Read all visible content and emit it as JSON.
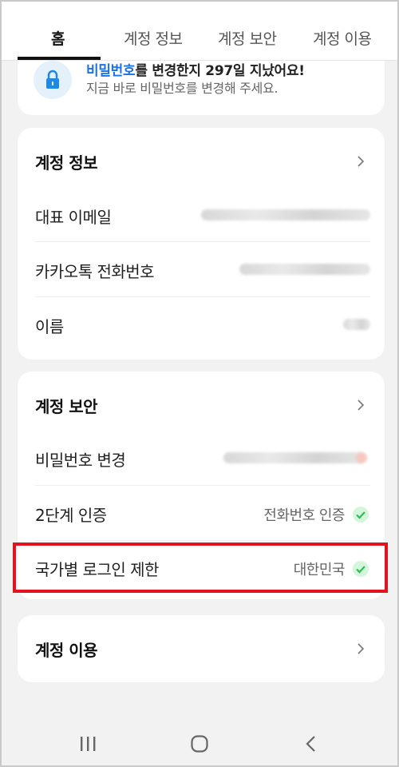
{
  "tabs": [
    {
      "label": "홈",
      "active": true
    },
    {
      "label": "계정 정보",
      "active": false
    },
    {
      "label": "계정 보안",
      "active": false
    },
    {
      "label": "계정 이용",
      "active": false
    }
  ],
  "notice": {
    "title_highlight": "비밀번호",
    "title_rest": "를 변경한지 297일 지났어요!",
    "subtitle": "지금 바로 비밀번호를 변경해 주세요.",
    "icon": "lock-icon"
  },
  "account_info": {
    "title": "계정 정보",
    "rows": [
      {
        "label": "대표 이메일"
      },
      {
        "label": "카카오톡 전화번호"
      },
      {
        "label": "이름"
      }
    ]
  },
  "account_security": {
    "title": "계정 보안",
    "rows": [
      {
        "label": "비밀번호 변경"
      },
      {
        "label": "2단계 인증",
        "value": "전화번호 인증"
      },
      {
        "label": "국가별 로그인 제한",
        "value": "대한민국"
      }
    ]
  },
  "account_usage": {
    "title": "계정 이용"
  },
  "colors": {
    "accent": "#1a73e8",
    "check": "#2fbf4f",
    "highlight": "#e0141e"
  },
  "navbar": {
    "icons": [
      "recent-apps-icon",
      "home-icon",
      "back-icon"
    ]
  }
}
